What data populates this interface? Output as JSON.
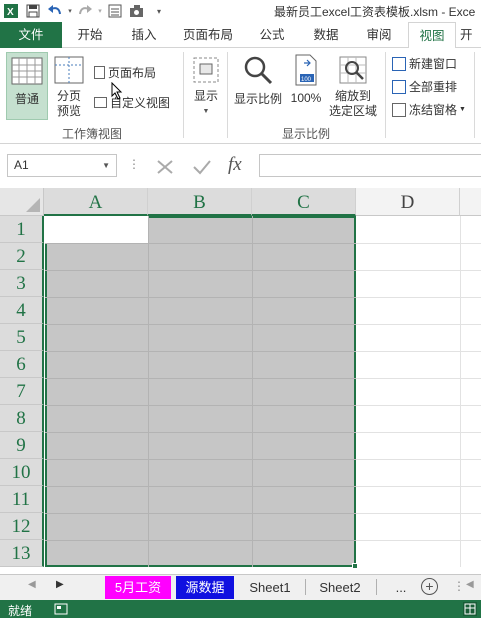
{
  "titlebar": {
    "title": "最新员工excel工资表模板.xlsm - Exce"
  },
  "tabs": [
    {
      "label": "文件"
    },
    {
      "label": "开始"
    },
    {
      "label": "插入"
    },
    {
      "label": "页面布局"
    },
    {
      "label": "公式"
    },
    {
      "label": "数据"
    },
    {
      "label": "审阅"
    },
    {
      "label": "视图"
    },
    {
      "label": "开"
    }
  ],
  "ribbon": {
    "normal": "普通",
    "page_break_1": "分页",
    "page_break_2": "预览",
    "page_layout": "页面布局",
    "custom_view": "自定义视图",
    "group_workbook_views": "工作簿视图",
    "show": "显示",
    "zoom": "显示比例",
    "zoom100": "100%",
    "zoom_sel_1": "缩放到",
    "zoom_sel_2": "选定区域",
    "group_zoom": "显示比例",
    "new_window": "新建窗口",
    "arrange_all": "全部重排",
    "freeze_panes": "冻结窗格",
    "zoom100_icon_text": "100"
  },
  "formula_bar": {
    "name_box": "A1",
    "fx": "fx",
    "value": ""
  },
  "columns": [
    "A",
    "B",
    "C",
    "D"
  ],
  "rows": [
    "1",
    "2",
    "3",
    "4",
    "5",
    "6",
    "7",
    "8",
    "9",
    "10",
    "11",
    "12",
    "13"
  ],
  "sheets": {
    "tabs": [
      "5月工资",
      "源数据",
      "Sheet1",
      "Sheet2"
    ],
    "more": "..."
  },
  "status": {
    "text": "就绪"
  },
  "colors": {
    "accent": "#217346",
    "tab_pink": "#ff00ff",
    "tab_blue": "#1010e0",
    "selection": "#c6c6c6"
  }
}
